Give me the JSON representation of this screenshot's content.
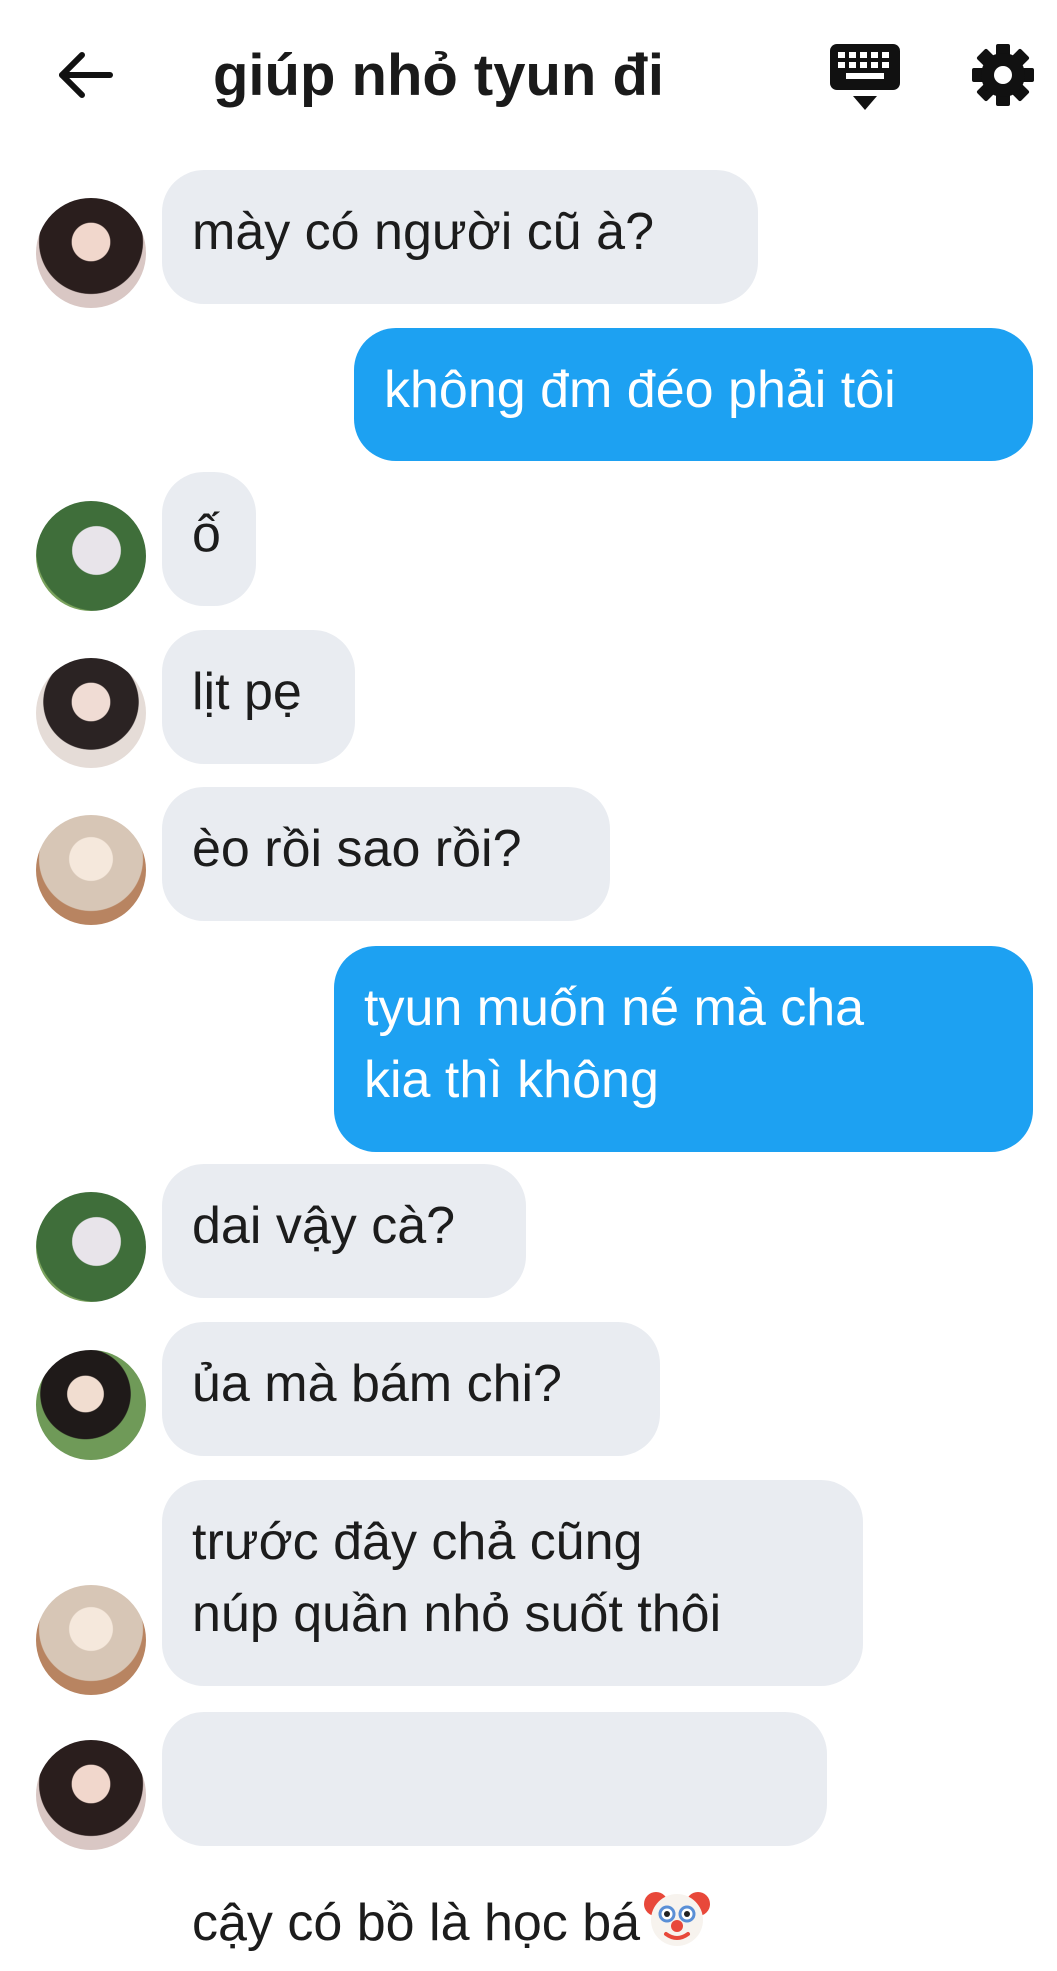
{
  "header": {
    "title": "giúp nhỏ tyun đi",
    "back_icon": "arrow-left-icon",
    "keyboard_icon": "keyboard-icon",
    "settings_icon": "gear-icon"
  },
  "colors": {
    "incoming_bubble": "#e9ecf1",
    "outgoing_bubble": "#1da1f2",
    "text": "#1c1c1c"
  },
  "messages": [
    {
      "side": "in",
      "text": "mày có người cũ à?"
    },
    {
      "side": "out",
      "text": "không đm đéo phải tôi"
    },
    {
      "side": "in",
      "text": "ố"
    },
    {
      "side": "in",
      "text": "lịt pẹ"
    },
    {
      "side": "in",
      "text": "èo rồi sao rồi?"
    },
    {
      "side": "out",
      "text": "tyun muốn né mà cha\nkia thì không"
    },
    {
      "side": "in",
      "text": "dai vậy cà?"
    },
    {
      "side": "in",
      "text": "ủa mà bám chi?"
    },
    {
      "side": "in",
      "text": "trước đây chả cũng\nnúp quần nhỏ suốt thôi"
    },
    {
      "side": "in",
      "text": "cậy có bồ là học bá",
      "emoji": "clown-face-icon"
    }
  ]
}
